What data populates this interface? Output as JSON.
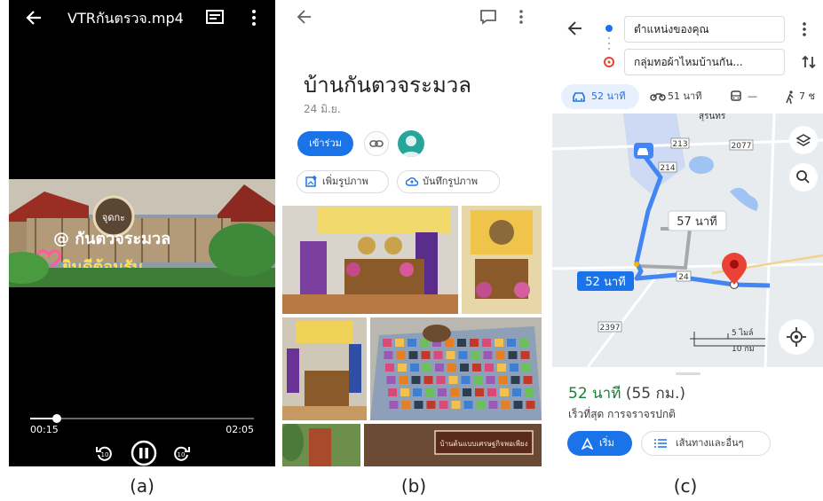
{
  "panel_a": {
    "title": "VTRกันตรวจ.mp4",
    "current_time": "00:15",
    "duration": "02:05",
    "progress": 0.12,
    "icons": [
      "back-arrow-icon",
      "subtitles-icon",
      "more-vert-icon",
      "replay-10-icon",
      "pause-icon",
      "forward-10-icon"
    ],
    "caption": "(a)"
  },
  "panel_b": {
    "place_name": "บ้านกันตวจระมวล",
    "date": "24 มิ.ย.",
    "join_label": "เข้าร่วม",
    "add_photos_label": "เพิ่มรูปภาพ",
    "save_photos_label": "บันทึกรูปภาพ",
    "photo_sign": "บ้านต้นแบบเศรษฐกิจพอเพียง",
    "caption": "(b)"
  },
  "panel_c": {
    "origin": "ตำแหน่งของคุณ",
    "destination": "กลุ่มทอผ้าไหมบ้านกัน...",
    "modes": {
      "car": "52 นาที",
      "bike": "51 นาที",
      "transit": "—",
      "walk": "7 ช"
    },
    "map": {
      "route_label": "52 นาที",
      "alt_route_label": "57 นาที",
      "road_numbers": [
        "213",
        "2077",
        "214",
        "24",
        "2397"
      ],
      "town": "สุรินทร์",
      "scale": [
        "5 ไมล์",
        "10 กม"
      ]
    },
    "summary_time": "52 นาที",
    "summary_dist": "(55 กม.)",
    "summary_sub": "เร็วที่สุด การจราจรปกติ",
    "start_label": "เริ่ม",
    "steps_label": "เส้นทางและอื่นๆ",
    "colors": {
      "route": "#4285f4",
      "pin": "#ea4335",
      "accent": "#1a73e8",
      "time_green": "#188038"
    },
    "caption": "(c)"
  }
}
